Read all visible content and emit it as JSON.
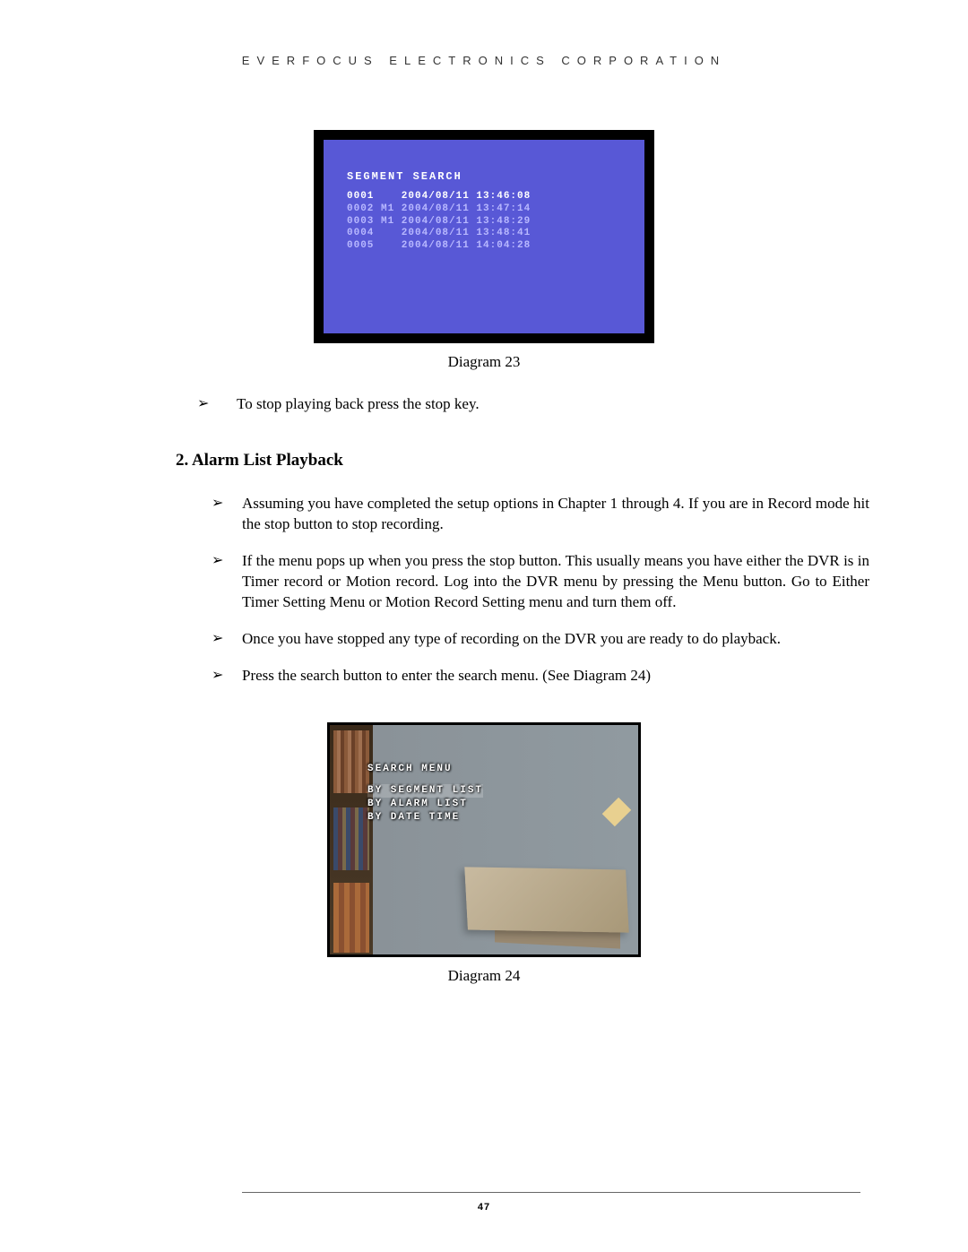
{
  "header": "EVERFOCUS ELECTRONICS CORPORATION",
  "diagram23": {
    "title": "SEGMENT SEARCH",
    "rows": [
      {
        "id": "0001",
        "flag": "  ",
        "date": "2004/08/11",
        "time": "13:46:08"
      },
      {
        "id": "0002",
        "flag": "M1",
        "date": "2004/08/11",
        "time": "13:47:14"
      },
      {
        "id": "0003",
        "flag": "M1",
        "date": "2004/08/11",
        "time": "13:48:29"
      },
      {
        "id": "0004",
        "flag": "  ",
        "date": "2004/08/11",
        "time": "13:48:41"
      },
      {
        "id": "0005",
        "flag": "  ",
        "date": "2004/08/11",
        "time": "14:04:28"
      }
    ],
    "caption": "Diagram 23"
  },
  "bullets_top": [
    "To stop playing back press the stop key."
  ],
  "section_heading": "2.  Alarm List Playback",
  "bullets_section": [
    "Assuming you have completed the setup options in Chapter 1 through 4. If you are in Record mode hit the stop button to stop recording.",
    "If the menu pops up when you press the stop button. This usually means you have either the DVR is in Timer record or Motion record. Log into the DVR menu by pressing the Menu button. Go to Either Timer Setting Menu or Motion Record Setting menu and turn them off.",
    "Once you have stopped any type of recording on the DVR you are ready to do playback.",
    "Press the search button to enter the search menu. (See Diagram 24)"
  ],
  "diagram24": {
    "title": "SEARCH MENU",
    "options": [
      "BY SEGMENT LIST",
      "BY ALARM LIST",
      "BY DATE TIME"
    ],
    "caption": "Diagram 24"
  },
  "page_number": "47"
}
